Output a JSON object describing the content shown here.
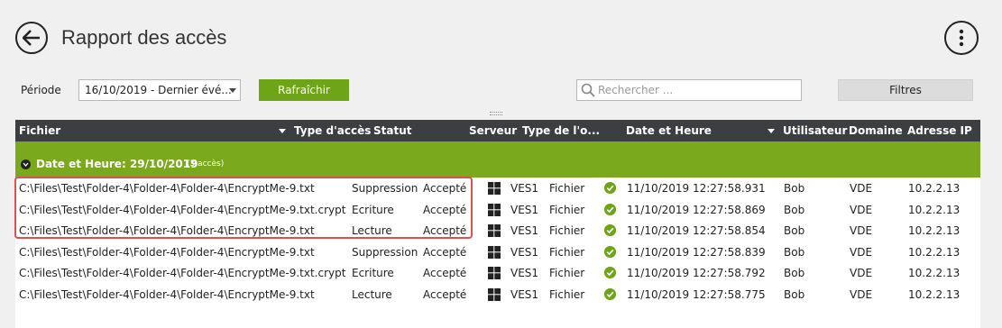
{
  "header": {
    "title": "Rapport des accès"
  },
  "toolbar": {
    "period_label": "Période",
    "period_value": "16/10/2019 - Dernier évé...",
    "refresh_label": "Rafraîchir",
    "search_placeholder": "Rechercher ...",
    "filters_label": "Filtres"
  },
  "grid": {
    "columns": [
      "Fichier",
      "Type d'accès",
      "Statut",
      "Serveur",
      "Type de l'o...",
      "Date et Heure",
      "Utilisateur",
      "Domaine",
      "Adresse IP"
    ],
    "group": {
      "label": "Date et Heure: 29/10/2019",
      "count": "(3 accès)"
    },
    "rows": [
      {
        "file": "C:\\Files\\Test\\Folder-4\\Folder-4\\Folder-4\\EncryptMe-9.txt",
        "access": "Suppression",
        "status": "Accepté",
        "server": "VES1",
        "type": "Fichier",
        "datetime": "11/10/2019 12:27:58.931",
        "user": "Bob",
        "domain": "VDE",
        "ip": "10.2.2.13"
      },
      {
        "file": "C:\\Files\\Test\\Folder-4\\Folder-4\\Folder-4\\EncryptMe-9.txt.crypt",
        "access": "Ecriture",
        "status": "Accepté",
        "server": "VES1",
        "type": "Fichier",
        "datetime": "11/10/2019 12:27:58.869",
        "user": "Bob",
        "domain": "VDE",
        "ip": "10.2.2.13"
      },
      {
        "file": "C:\\Files\\Test\\Folder-4\\Folder-4\\Folder-4\\EncryptMe-9.txt",
        "access": "Lecture",
        "status": "Accepté",
        "server": "VES1",
        "type": "Fichier",
        "datetime": "11/10/2019 12:27:58.854",
        "user": "Bob",
        "domain": "VDE",
        "ip": "10.2.2.13"
      },
      {
        "file": "C:\\Files\\Test\\Folder-4\\Folder-4\\Folder-4\\EncryptMe-9.txt",
        "access": "Suppression",
        "status": "Accepté",
        "server": "VES1",
        "type": "Fichier",
        "datetime": "11/10/2019 12:27:58.839",
        "user": "Bob",
        "domain": "VDE",
        "ip": "10.2.2.13"
      },
      {
        "file": "C:\\Files\\Test\\Folder-4\\Folder-4\\Folder-4\\EncryptMe-9.txt.crypt",
        "access": "Ecriture",
        "status": "Accepté",
        "server": "VES1",
        "type": "Fichier",
        "datetime": "11/10/2019 12:27:58.792",
        "user": "Bob",
        "domain": "VDE",
        "ip": "10.2.2.13"
      },
      {
        "file": "C:\\Files\\Test\\Folder-4\\Folder-4\\Folder-4\\EncryptMe-9.txt",
        "access": "Lecture",
        "status": "Accepté",
        "server": "VES1",
        "type": "Fichier",
        "datetime": "11/10/2019 12:27:58.775",
        "user": "Bob",
        "domain": "VDE",
        "ip": "10.2.2.13"
      }
    ]
  },
  "colors": {
    "accent_green": "#7aa91e",
    "header_dark": "#3b3f42",
    "highlight_red": "#d9534f"
  },
  "icons": [
    "back-arrow-icon",
    "more-vertical-icon",
    "search-icon",
    "windows-icon",
    "check-circle-icon",
    "sort-down-icon",
    "group-collapse-icon"
  ]
}
